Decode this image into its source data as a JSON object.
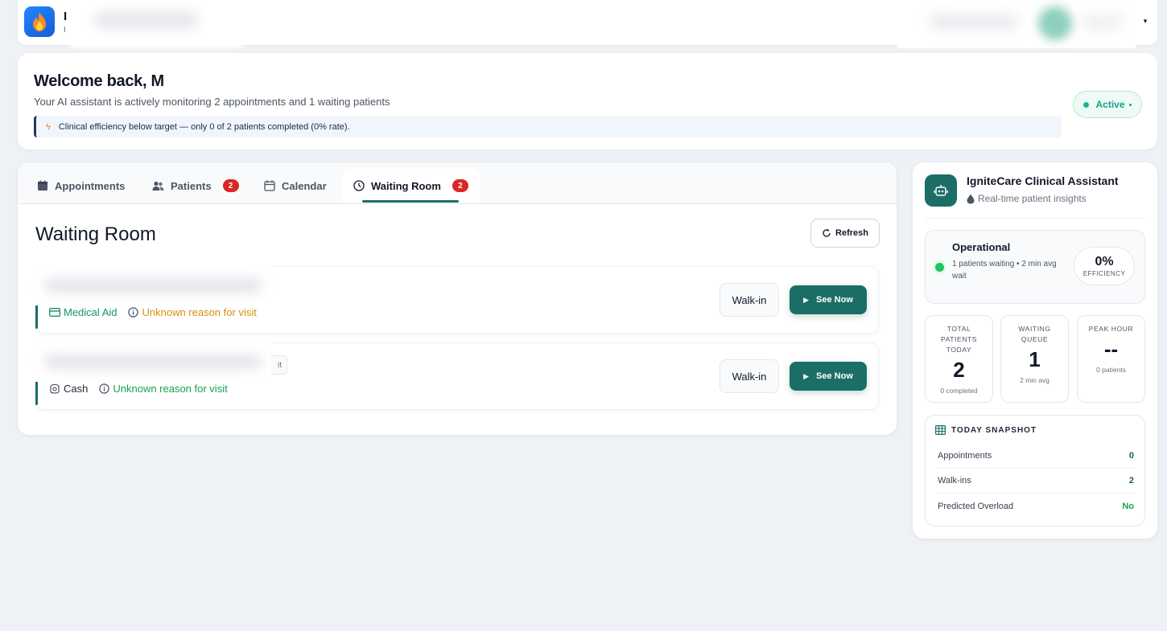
{
  "header": {
    "brand_name": "I",
    "brand_sub": "I",
    "caret": "▾"
  },
  "welcome": {
    "title": "Welcome back, M",
    "subtitle": "Your AI assistant is actively monitoring 2 appointments and 1 waiting patients",
    "alert": "Clinical efficiency below target — only 0 of 2 patients completed (0% rate).",
    "status": "Active"
  },
  "tabs": [
    {
      "label": "Appointments",
      "badge": ""
    },
    {
      "label": "Patients",
      "badge": "2"
    },
    {
      "label": "Calendar",
      "badge": ""
    },
    {
      "label": "Waiting Room",
      "badge": "2"
    }
  ],
  "waiting_room": {
    "title": "Waiting Room",
    "refresh_label": "Refresh",
    "patients": [
      {
        "payment": "Medical Aid",
        "reason": "Unknown reason for visit",
        "tag": "",
        "walkin_label": "Walk-in",
        "see_label": "See Now"
      },
      {
        "payment": "Cash",
        "reason": "Unknown reason for visit",
        "tag": "it",
        "walkin_label": "Walk-in",
        "see_label": "See Now"
      }
    ]
  },
  "assistant": {
    "title": "IgniteCare Clinical Assistant",
    "subtitle": "Real-time patient insights",
    "status_title": "Operational",
    "status_desc": "1 patients waiting • 2 min avg wait",
    "efficiency_value": "0%",
    "efficiency_label": "EFFICIENCY",
    "stats": [
      {
        "label": "Total Patients Today",
        "value": "2",
        "foot": "0 completed"
      },
      {
        "label": "Waiting Queue",
        "value": "1",
        "foot": "2 min avg"
      },
      {
        "label": "Peak Hour",
        "value": "--",
        "foot": "0 patients"
      }
    ],
    "snapshot": {
      "title": "TODAY SNAPSHOT",
      "rows": [
        {
          "label": "Appointments",
          "value": "0"
        },
        {
          "label": "Walk-ins",
          "value": "2"
        },
        {
          "label": "Predicted Overload",
          "value": "No"
        }
      ]
    }
  },
  "colors": {
    "primary": "#1b6e66",
    "badge": "#dc2626",
    "success": "#16a34a",
    "warning": "#d98e0b",
    "background": "#eef1f5"
  }
}
